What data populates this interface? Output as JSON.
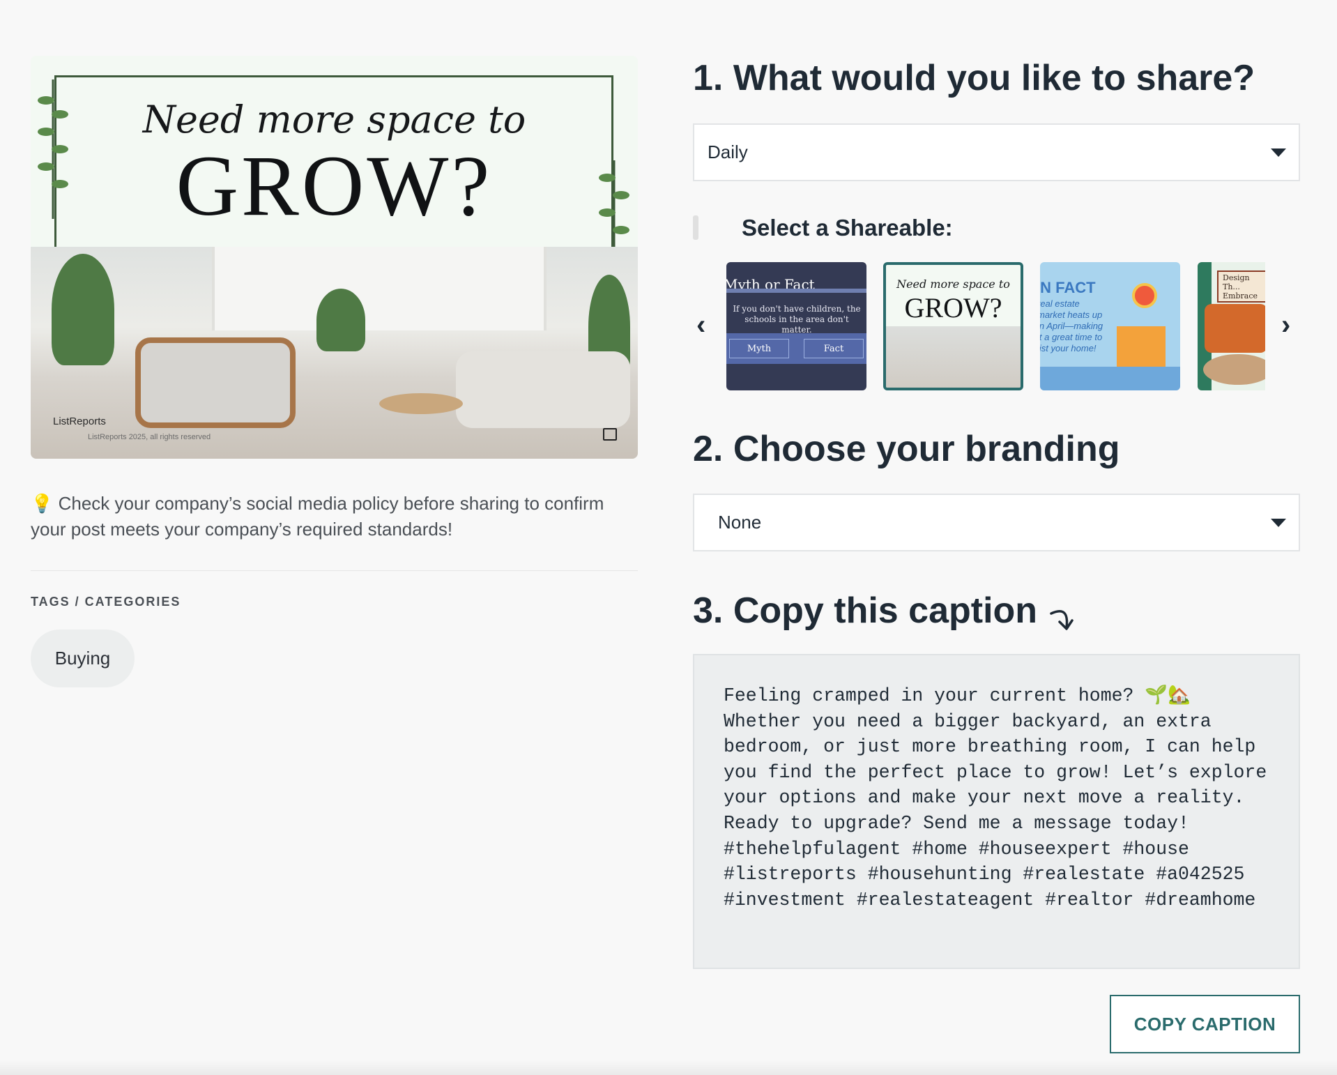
{
  "preview": {
    "headline_line1": "Need more space to",
    "headline_line2": "GROW?",
    "brand": "ListReports",
    "copyright": "ListReports 2025, all rights reserved"
  },
  "tip": {
    "icon": "lightbulb-icon",
    "text": "Check your company’s social media policy before sharing to confirm your post meets your company’s required standards!"
  },
  "tags": {
    "heading": "TAGS / CATEGORIES",
    "items": [
      "Buying"
    ]
  },
  "step1": {
    "title": "1. What would you like to share?",
    "select_value": "Daily",
    "shareable_label": "Select a Shareable:"
  },
  "thumbnails": [
    {
      "title": "Myth or Fact",
      "body": "If you don't have children, the schools in the area don't matter.",
      "buttons": [
        "Myth",
        "Fact"
      ]
    },
    {
      "headline_line1": "Need more space to",
      "headline_line2": "GROW?",
      "selected": true
    },
    {
      "headline": "IN FACT",
      "body": "real estate market heats up in April—making it a great time to list your home!"
    },
    {
      "headline": "Design Th... Embrace"
    }
  ],
  "step2": {
    "title": "2. Choose your branding",
    "select_value": "None"
  },
  "step3": {
    "title": "3. Copy this caption",
    "caption": "Feeling cramped in your current home? 🌱🏡 Whether you need a bigger backyard, an extra bedroom, or just more breathing room, I can help you find the perfect place to grow! Let’s explore your options and make your next move a reality. Ready to upgrade? Send me a message today! #thehelpfulagent #home #houseexpert #house #listreports #househunting #realestate #a042525 #investment #realestateagent #realtor #dreamhome",
    "copy_button": "COPY CAPTION"
  },
  "colors": {
    "accent": "#2a6b6c",
    "heading": "#1f2a35",
    "background": "#f8f8f8"
  }
}
